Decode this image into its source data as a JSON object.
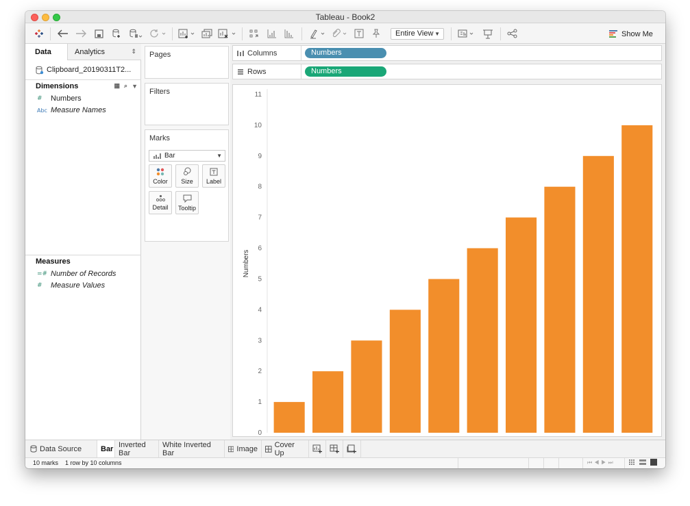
{
  "window": {
    "title": "Tableau - Book2"
  },
  "toolbar": {
    "view_select": "Entire View",
    "show_me": "Show Me"
  },
  "left_panel": {
    "tabs": {
      "data": "Data",
      "analytics": "Analytics"
    },
    "data_source": "Clipboard_20190311T2...",
    "dimensions_header": "Dimensions",
    "dimensions": [
      {
        "icon": "#",
        "label": "Numbers",
        "italic": false
      },
      {
        "icon": "Abc",
        "label": "Measure Names",
        "italic": true
      }
    ],
    "measures_header": "Measures",
    "measures": [
      {
        "icon": "=#",
        "label": "Number of Records",
        "italic": true
      },
      {
        "icon": "#",
        "label": "Measure Values",
        "italic": true
      }
    ]
  },
  "cards": {
    "pages": "Pages",
    "filters": "Filters",
    "marks": "Marks",
    "mark_type": "Bar",
    "mark_buttons": {
      "color": "Color",
      "size": "Size",
      "label": "Label",
      "detail": "Detail",
      "tooltip": "Tooltip"
    }
  },
  "shelves": {
    "columns_label": "Columns",
    "columns_pill": "Numbers",
    "rows_label": "Rows",
    "rows_pill": "Numbers"
  },
  "sheet_tabs": {
    "data_source": "Data Source",
    "sheets": [
      "Bar",
      "Inverted Bar",
      "White Inverted Bar",
      "Image",
      "Cover Up"
    ]
  },
  "status": {
    "marks": "10 marks",
    "dims": "1 row by 10 columns"
  },
  "colors": {
    "bar": "#f28e2b",
    "columns_pill": "#4a8fb0",
    "rows_pill": "#1aa777"
  },
  "chart_data": {
    "type": "bar",
    "ylabel": "Numbers",
    "values": [
      1,
      2,
      3,
      4,
      5,
      6,
      7,
      8,
      9,
      10
    ],
    "ylim": [
      0,
      11
    ],
    "yticks": [
      0,
      1,
      2,
      3,
      4,
      5,
      6,
      7,
      8,
      9,
      10,
      11
    ],
    "grid": false
  }
}
